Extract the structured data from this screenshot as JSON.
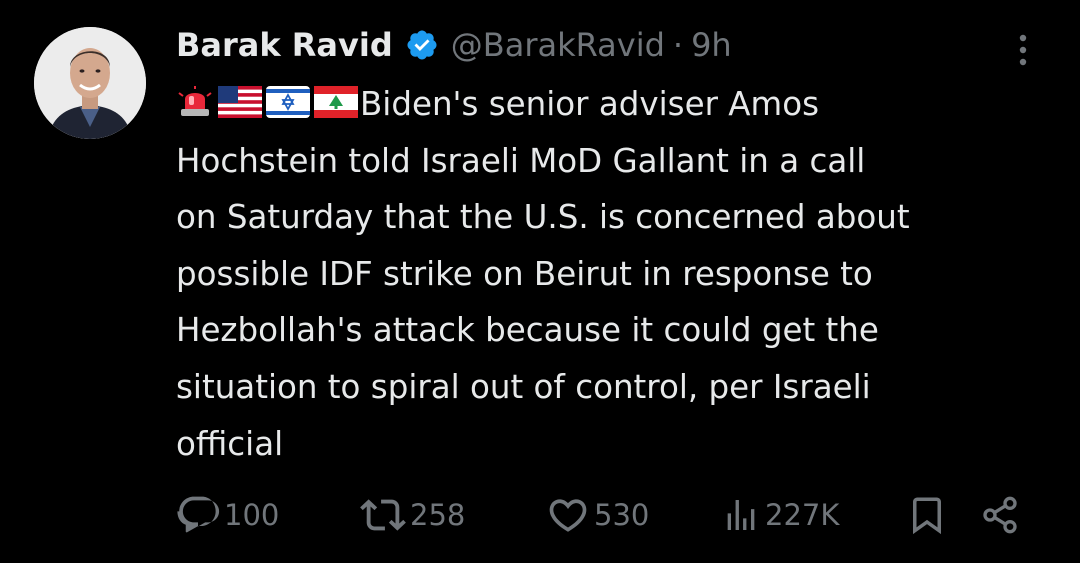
{
  "author": {
    "display_name": "Barak Ravid",
    "handle": "@BarakRavid",
    "separator": "·",
    "time": "9h",
    "verified": true
  },
  "tweet": {
    "emoji": [
      "police-light",
      "flag-us",
      "flag-israel",
      "flag-lebanon"
    ],
    "lines": [
      "Biden's senior adviser Amos",
      "Hochstein told Israeli MoD Gallant in a call",
      "on Saturday that the U.S. is concerned about",
      "possible IDF strike on Beirut in response to",
      "Hezbollah's attack because it could get the",
      "situation to spiral out of control, per Israeli",
      "official"
    ]
  },
  "actions": {
    "replies": "100",
    "reposts": "258",
    "likes": "530",
    "views": "227K"
  },
  "colors": {
    "background": "#000000",
    "text": "#e7e9ea",
    "secondary": "#71767b",
    "verified": "#1d9bf0"
  }
}
